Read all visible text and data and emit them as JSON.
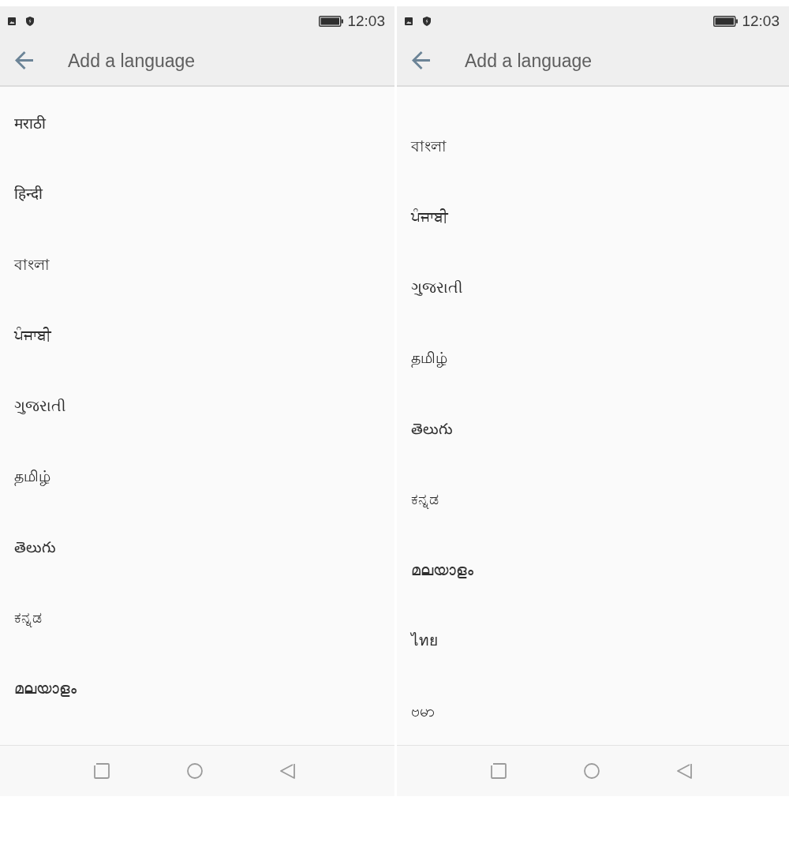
{
  "screens": [
    {
      "status_bar": {
        "time": "12:03"
      },
      "toolbar": {
        "title": "Add a language"
      },
      "languages": [
        "मराठी",
        "हिन्दी",
        "বাংলা",
        "ਪੰਜਾਬੀ",
        "ગુજરાતી",
        "தமிழ்",
        "తెలుగు",
        "ಕನ್ನಡ",
        "മലയാളം"
      ]
    },
    {
      "status_bar": {
        "time": "12:03"
      },
      "toolbar": {
        "title": "Add a language"
      },
      "languages": [
        "বাংলা",
        "ਪੰਜਾਬੀ",
        "ગુજરાતી",
        "தமிழ்",
        "తెలుగు",
        "ಕನ್ನಡ",
        "മലയാളം",
        "ไทย",
        "ဗမာ"
      ]
    }
  ]
}
